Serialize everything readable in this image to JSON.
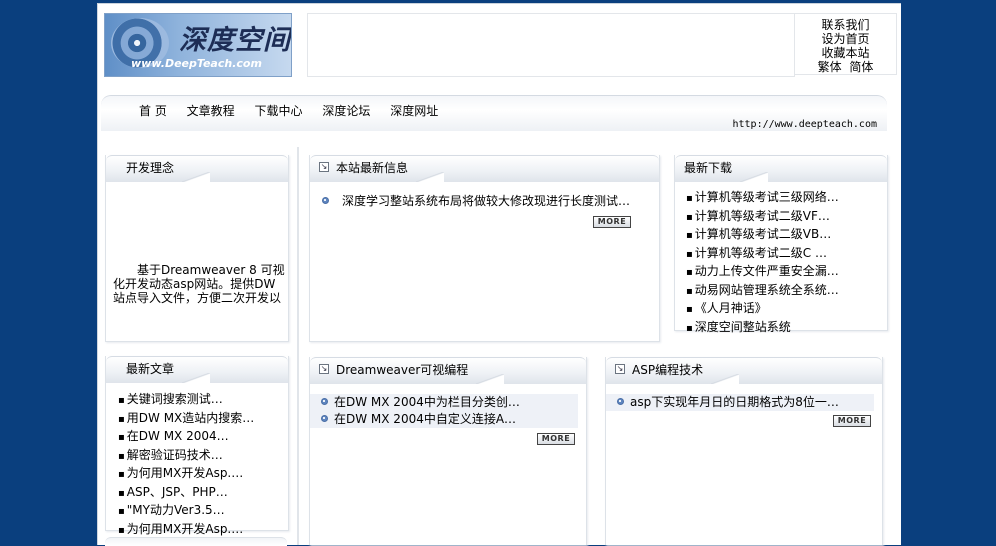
{
  "logo": {
    "title": "深度空间",
    "url": "www.DeepTeach.com"
  },
  "toplinks": [
    "联系我们",
    "设为首页",
    "收藏本站"
  ],
  "lang": {
    "trad": "繁体",
    "simp": "简体"
  },
  "nav": {
    "items": [
      "首 页",
      "文章教程",
      "下载中心",
      "深度论坛",
      "深度网址"
    ],
    "url": "http://www.deepteach.com"
  },
  "philosophy": {
    "title": "开发理念",
    "text": "　　基于Dreamweaver 8 可视化开发动态asp网站。提供DW站点导入文件，方便二次开发以"
  },
  "news": {
    "title": "本站最新信息",
    "items": [
      "深度学习整站系统布局将做较大修改现进行长度测试…"
    ],
    "more": "MORE"
  },
  "downloads": {
    "title": "最新下载",
    "items": [
      "计算机等级考试三级网络…",
      "计算机等级考试二级VF…",
      "计算机等级考试二级VB…",
      "计算机等级考试二级C …",
      "动力上传文件严重安全漏…",
      "动易网站管理系统全系统…",
      "《人月神话》",
      "深度空间整站系统"
    ]
  },
  "latest": {
    "title": "最新文章",
    "items": [
      "关键词搜索测试…",
      "用DW MX造站内搜索…",
      "在DW MX 2004…",
      "解密验证码技术…",
      "为何用MX开发Asp.…",
      "ASP、JSP、PHP…",
      "\"MY动力Ver3.5…",
      "为何用MX开发Asp.…"
    ]
  },
  "dw": {
    "title": "Dreamweaver可视编程",
    "items": [
      "在DW MX 2004中为栏目分类创…",
      "在DW MX 2004中自定义连接A…"
    ],
    "more": "MORE"
  },
  "asp": {
    "title": "ASP编程技术",
    "items": [
      "asp下实现年月日的日期格式为8位一…"
    ],
    "more": "MORE"
  },
  "icons": {
    "list_arrow": "arrow-icon",
    "bullet": "round-bullet-icon"
  },
  "colors": {
    "background": "#0a3f7e",
    "page": "#ffffff"
  }
}
